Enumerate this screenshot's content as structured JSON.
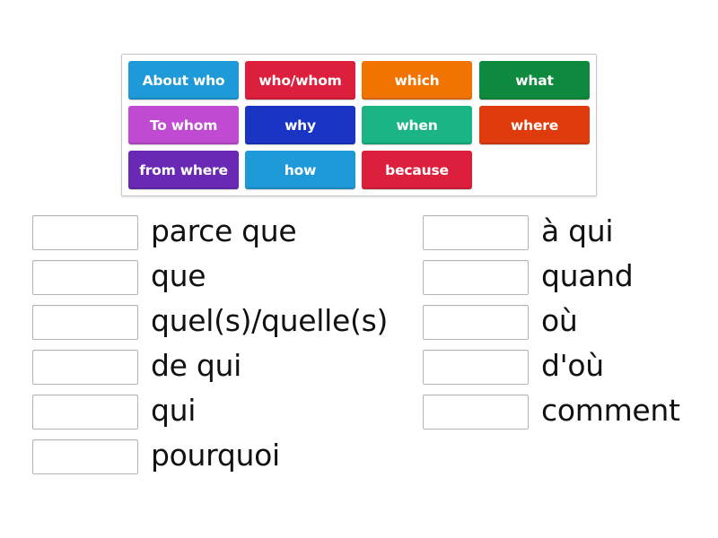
{
  "tiles": [
    {
      "label": "About who",
      "color": "#1f9ad8"
    },
    {
      "label": "who/whom",
      "color": "#dc1f3d"
    },
    {
      "label": "which",
      "color": "#f17300"
    },
    {
      "label": "what",
      "color": "#0d8a3e"
    },
    {
      "label": "To whom",
      "color": "#c04ad1"
    },
    {
      "label": "why",
      "color": "#1a35c4"
    },
    {
      "label": "when",
      "color": "#1bb584"
    },
    {
      "label": "where",
      "color": "#e03b0c"
    },
    {
      "label": "from where",
      "color": "#6a29b5"
    },
    {
      "label": "how",
      "color": "#1f9ad8"
    },
    {
      "label": "because",
      "color": "#dc1f3d"
    }
  ],
  "left_prompts": [
    {
      "text": "parce que"
    },
    {
      "text": "que"
    },
    {
      "text": "quel(s)/quelle(s)"
    },
    {
      "text": "de qui"
    },
    {
      "text": "qui"
    },
    {
      "text": "pourquoi"
    }
  ],
  "right_prompts": [
    {
      "text": "à qui"
    },
    {
      "text": "quand"
    },
    {
      "text": "où"
    },
    {
      "text": "d'où"
    },
    {
      "text": "comment"
    }
  ]
}
